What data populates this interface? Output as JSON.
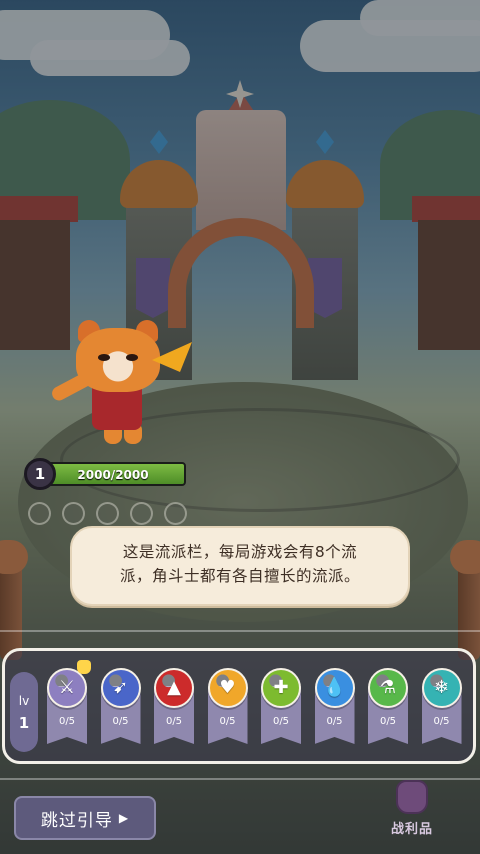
{
  "hud": {
    "level": "1",
    "hp_text": "2000/2000",
    "hp_fraction": 1.0
  },
  "dialog": {
    "line1": "这是流派栏，每局游戏会有8个流",
    "line2": "派，角斗士都有各自擅长的流派。"
  },
  "faction_bar": {
    "lv_label": "lv",
    "lv_value": "1",
    "factions": [
      {
        "icon": "sword-icon",
        "glyph": "⚔",
        "color": "#8d7fc0",
        "count": "0/5"
      },
      {
        "icon": "boot-icon",
        "glyph": "➹",
        "color": "#4a66c9",
        "count": "0/5"
      },
      {
        "icon": "flame-icon",
        "glyph": "▲",
        "color": "#cc2b2b",
        "count": "0/5"
      },
      {
        "icon": "heart-icon",
        "glyph": "♥",
        "color": "#f0a72a",
        "count": "0/5"
      },
      {
        "icon": "cross-icon",
        "glyph": "✚",
        "color": "#7dbb2f",
        "count": "0/5"
      },
      {
        "icon": "drop-icon",
        "glyph": "💧",
        "color": "#3a8fe0",
        "count": "0/5"
      },
      {
        "icon": "potion-icon",
        "glyph": "⚗",
        "color": "#58b84a",
        "count": "0/5"
      },
      {
        "icon": "snowflake-icon",
        "glyph": "❄",
        "color": "#35b3b3",
        "count": "0/5"
      }
    ]
  },
  "buttons": {
    "skip_guide": "跳过引导",
    "loot": "战利品"
  }
}
